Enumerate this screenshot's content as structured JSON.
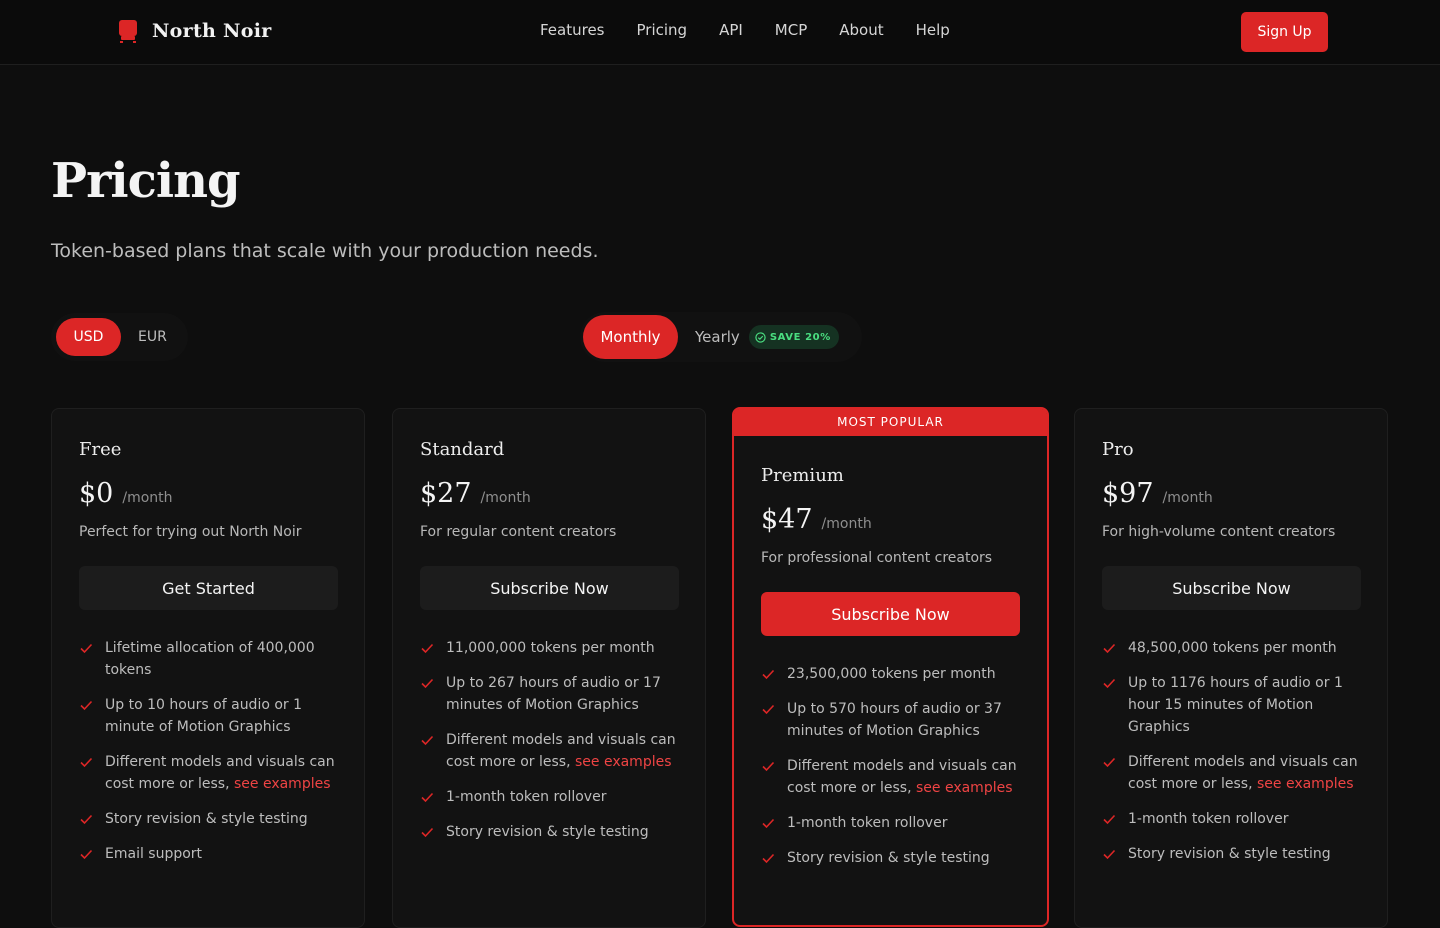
{
  "header": {
    "brand": "North Noir",
    "nav": [
      "Features",
      "Pricing",
      "API",
      "MCP",
      "About",
      "Help"
    ],
    "signup_label": "Sign Up"
  },
  "hero": {
    "title": "Pricing",
    "subtitle": "Token-based plans that scale with your production needs."
  },
  "currency": {
    "options": [
      "USD",
      "EUR"
    ],
    "selected": "USD"
  },
  "billing": {
    "monthly": "Monthly",
    "yearly": "Yearly",
    "save_badge": "SAVE 20%",
    "selected": "Monthly"
  },
  "colors": {
    "accent": "#dc2626",
    "save_green": "#4ade80",
    "background": "#0e0e0e"
  },
  "plans": [
    {
      "name": "Free",
      "price": "$0",
      "period": "/month",
      "desc": "Perfect for trying out North Noir",
      "cta": "Get Started",
      "features": [
        "Lifetime allocation of 400,000 tokens",
        "Up to 10 hours of audio or 1 minute of Motion Graphics",
        "Different models and visuals can cost more or less, ",
        "Story revision & style testing",
        "Email support"
      ],
      "link_text": "see examples"
    },
    {
      "name": "Standard",
      "price": "$27",
      "period": "/month",
      "desc": "For regular content creators",
      "cta": "Subscribe Now",
      "features": [
        "11,000,000 tokens per month",
        "Up to 267 hours of audio or 17 minutes of Motion Graphics",
        "Different models and visuals can cost more or less, ",
        "1-month token rollover",
        "Story revision & style testing"
      ],
      "link_text": "see examples"
    },
    {
      "name": "Premium",
      "price": "$47",
      "period": "/month",
      "desc": "For professional content creators",
      "cta": "Subscribe Now",
      "banner": "MOST POPULAR",
      "features": [
        "23,500,000 tokens per month",
        "Up to 570 hours of audio or 37 minutes of Motion Graphics",
        "Different models and visuals can cost more or less, ",
        "1-month token rollover",
        "Story revision & style testing"
      ],
      "link_text": "see examples"
    },
    {
      "name": "Pro",
      "price": "$97",
      "period": "/month",
      "desc": "For high-volume content creators",
      "cta": "Subscribe Now",
      "features": [
        "48,500,000 tokens per month",
        "Up to 1176 hours of audio or 1 hour 15 minutes of Motion Graphics",
        "Different models and visuals can cost more or less, ",
        "1-month token rollover",
        "Story revision & style testing"
      ],
      "link_text": "see examples"
    }
  ]
}
